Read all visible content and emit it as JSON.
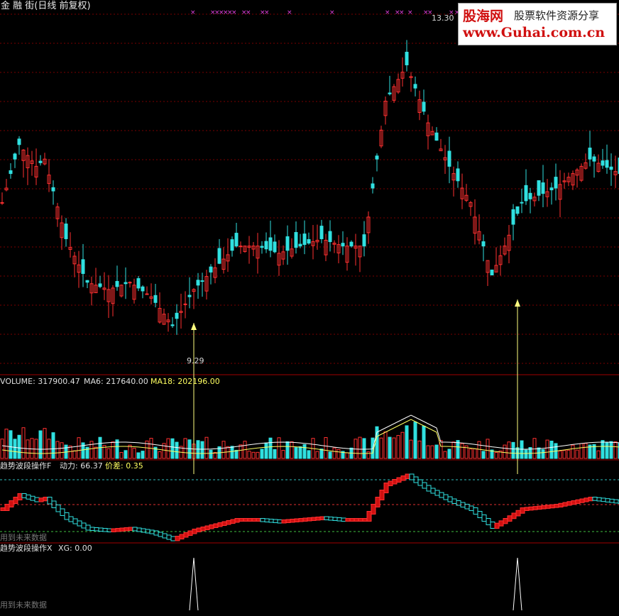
{
  "app": {
    "title": "金 融 街(日线 前复权)"
  },
  "watermark": {
    "brand": "股海网",
    "slogan": "股票软件资源分享",
    "url": "www.Guhai.com.cn"
  },
  "price_panel": {
    "high_label": "13.30",
    "low_label": "9.29"
  },
  "volume_panel": {
    "title": "VOLUME: 317900.47",
    "ma6": "MA6: 217640.00",
    "ma18": "MA18: 202196.00"
  },
  "indicator1": {
    "title": "趋势波段操作F",
    "dongli": "动力: 66.37",
    "jiacha": "价差: 0.35",
    "note": "用到未来数据"
  },
  "indicator2": {
    "title": "趋势波段操作X",
    "xg": "XG: 0.00",
    "note": "用到未来数据"
  },
  "colors": {
    "up": "#ff3030",
    "down": "#30e0e0",
    "ma6": "#ffffff",
    "ma18": "#ffff60",
    "grid": "#7a0000",
    "x_marks": "#e040e0",
    "arrow": "#ffff80"
  },
  "chart_data": [
    {
      "type": "candlestick",
      "title": "金 融 街(日线 前复权)",
      "ylim": [
        8.8,
        13.6
      ],
      "annotations": [
        "13.30",
        "9.29"
      ]
    },
    {
      "type": "bar",
      "title": "VOLUME",
      "series": [
        {
          "name": "VOLUME"
        },
        {
          "name": "MA6"
        },
        {
          "name": "MA18"
        }
      ]
    },
    {
      "type": "line",
      "title": "趋势波段操作F",
      "ylim": [
        0,
        100
      ]
    },
    {
      "type": "line",
      "title": "趋势波段操作X",
      "ylim": [
        0,
        1
      ]
    }
  ]
}
